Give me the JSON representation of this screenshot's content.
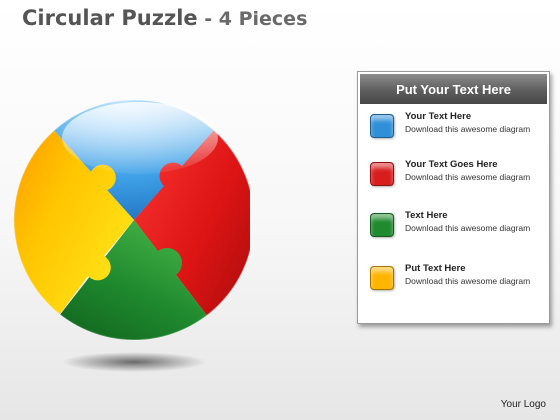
{
  "slide": {
    "title_main": "Circular Puzzle",
    "title_suffix": " - 4 Pieces"
  },
  "puzzle": {
    "pieces": [
      {
        "name": "blue",
        "color": "#2f8fd8"
      },
      {
        "name": "red",
        "color": "#d81d1d"
      },
      {
        "name": "green",
        "color": "#1f8a2e"
      },
      {
        "name": "yellow",
        "color": "#ffb400"
      }
    ]
  },
  "legend": {
    "header": "Put Your Text Here",
    "items": [
      {
        "title": "Your Text Here",
        "description": "Download this awesome diagram",
        "color": "#2f8fd8",
        "icon": "blue-square-icon"
      },
      {
        "title": "Your Text Goes Here",
        "description": "Download this awesome diagram",
        "color": "#d81d1d",
        "icon": "red-square-icon"
      },
      {
        "title": "Text Here",
        "description": "Download this awesome diagram",
        "color": "#1f8a2e",
        "icon": "green-square-icon"
      },
      {
        "title": "Put Text Here",
        "description": "Download this awesome diagram",
        "color": "#ffb400",
        "icon": "orange-square-icon"
      }
    ]
  },
  "footer": {
    "logo": "Your Logo"
  }
}
